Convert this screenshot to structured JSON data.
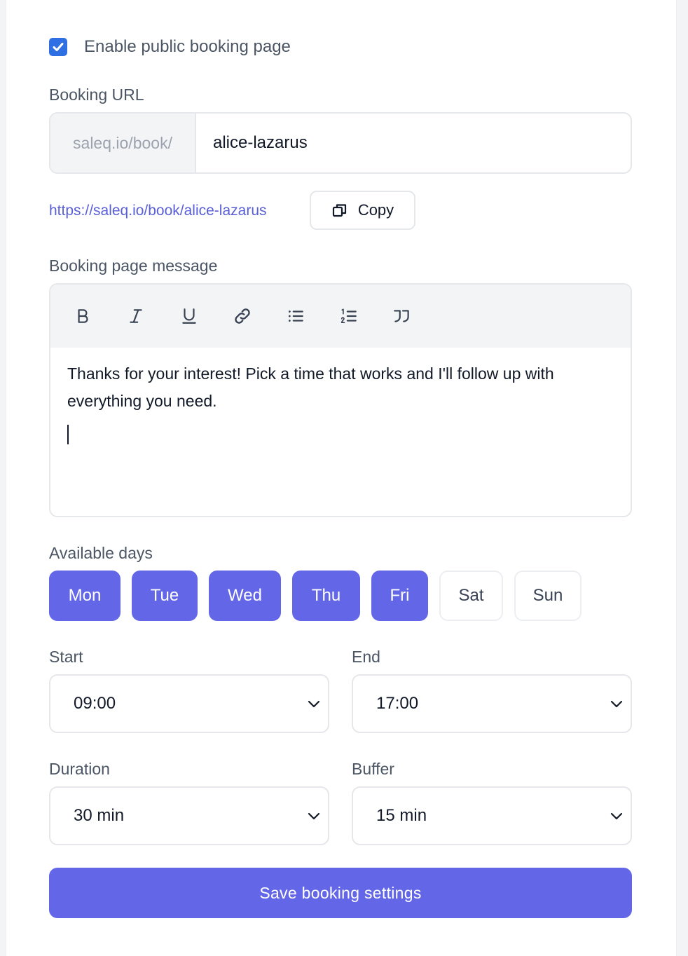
{
  "public_page": {
    "enabled": true,
    "label": "Enable public booking page"
  },
  "booking_url": {
    "label": "Booking URL",
    "prefix": "saleq.io/book/",
    "slug": "alice-lazarus",
    "full_url": "https://saleq.io/book/alice-lazarus",
    "copy_label": "Copy"
  },
  "message": {
    "label": "Booking page message",
    "toolbar": [
      "bold-icon",
      "italic-icon",
      "underline-icon",
      "link-icon",
      "bullet-list-icon",
      "numbered-list-icon",
      "quote-icon"
    ],
    "text": "Thanks for your interest! Pick a time that works and I'll follow up with everything you need."
  },
  "days": {
    "label": "Available days",
    "items": [
      {
        "label": "Mon",
        "selected": true
      },
      {
        "label": "Tue",
        "selected": true
      },
      {
        "label": "Wed",
        "selected": true
      },
      {
        "label": "Thu",
        "selected": true
      },
      {
        "label": "Fri",
        "selected": true
      },
      {
        "label": "Sat",
        "selected": false
      },
      {
        "label": "Sun",
        "selected": false
      }
    ]
  },
  "start": {
    "label": "Start",
    "value": "09:00"
  },
  "end": {
    "label": "End",
    "value": "17:00"
  },
  "duration": {
    "label": "Duration",
    "value": "30 min"
  },
  "buffer": {
    "label": "Buffer",
    "value": "15 min"
  },
  "save_label": "Save booking settings",
  "colors": {
    "accent": "#6366e6",
    "checkbox": "#2f6fe4",
    "link": "#5a5fd6"
  }
}
